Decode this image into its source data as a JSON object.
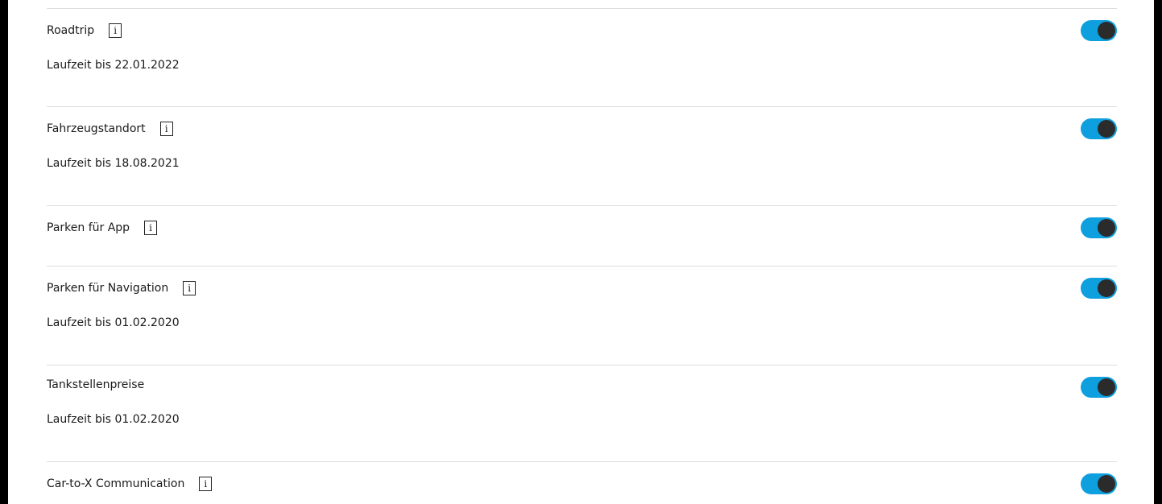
{
  "settings": {
    "items": [
      {
        "label": "Roadtrip",
        "runtime": "Laufzeit bis 22.01.2022"
      },
      {
        "label": "Fahrzeugstandort",
        "runtime": "Laufzeit bis 18.08.2021"
      },
      {
        "label": "Parken für App"
      },
      {
        "label": "Parken für Navigation",
        "runtime": "Laufzeit bis 01.02.2020"
      },
      {
        "label": "Tankstellenpreise",
        "runtime": "Laufzeit bis 01.02.2020"
      },
      {
        "label": "Car-to-X Communication"
      }
    ],
    "info_glyph": "i",
    "toggle_state": "on",
    "accent_color": "#0e9fde",
    "knob_color": "#2b2b2b"
  }
}
